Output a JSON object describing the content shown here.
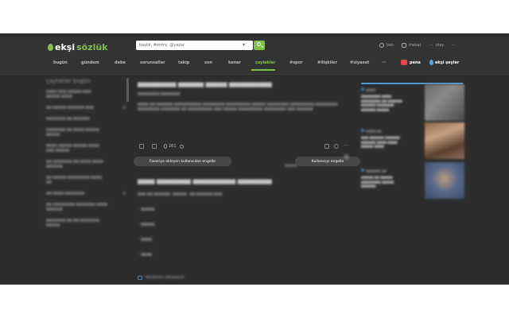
{
  "header": {
    "logo_left": "ekşi",
    "logo_right": "sözlük",
    "search_placeholder": "başlık, #entry, @yazar",
    "user_menu": [
      {
        "label": "ben",
        "icon": "user-icon"
      },
      {
        "label": "mesaj",
        "icon": "message-icon"
      },
      {
        "label": "olay",
        "icon": "dots-icon"
      }
    ]
  },
  "nav": {
    "tabs": [
      {
        "label": "bugün",
        "active": false
      },
      {
        "label": "gündem",
        "active": false
      },
      {
        "label": "debe",
        "active": false
      },
      {
        "label": "sorunsallar",
        "active": false
      },
      {
        "label": "takip",
        "active": false
      },
      {
        "label": "son",
        "active": false
      },
      {
        "label": "kenar",
        "active": false
      },
      {
        "label": "çaylaklar",
        "active": true
      },
      {
        "label": "#spor",
        "active": false
      },
      {
        "label": "#ilişkiler",
        "active": false
      },
      {
        "label": "#siyaset",
        "active": false
      },
      {
        "label": "···",
        "active": false
      }
    ],
    "pena_label": "pena",
    "eksiseyler_label": "ekşi şeyler"
  },
  "sidebar": {
    "title": "çaylaklar bugün"
  },
  "entry": {
    "favorite_count": "261"
  },
  "buttons": {
    "block_favoriters": "Favoriye ekleyen kullanıcıları engelle",
    "block_user": "Kullanıcıyı engelle"
  },
  "readmore": {
    "label": "devamını okuyayım"
  },
  "colors": {
    "accent": "#81c14b",
    "background": "#2d2d2d",
    "header": "#333333",
    "pena": "#e8454a",
    "eksiseyler": "#53a8e2"
  }
}
